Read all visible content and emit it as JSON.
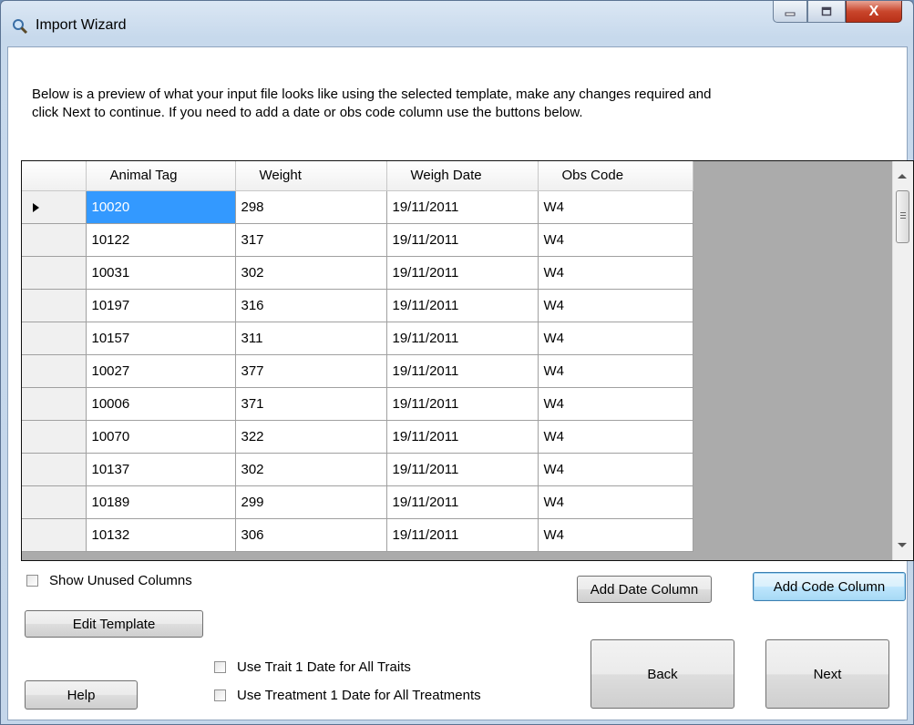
{
  "window": {
    "title": "Import Wizard"
  },
  "instructions": {
    "line1": "Below is a preview of what your input file looks like using the selected template, make any changes required and",
    "line2": "click Next to continue. If you need to add a date or obs code column use the buttons below."
  },
  "grid": {
    "columns": [
      "Animal Tag",
      "Weight",
      "Weigh Date",
      "Obs Code"
    ],
    "rows": [
      [
        "10020",
        "298",
        "19/11/2011",
        "W4"
      ],
      [
        "10122",
        "317",
        "19/11/2011",
        "W4"
      ],
      [
        "10031",
        "302",
        "19/11/2011",
        "W4"
      ],
      [
        "10197",
        "316",
        "19/11/2011",
        "W4"
      ],
      [
        "10157",
        "311",
        "19/11/2011",
        "W4"
      ],
      [
        "10027",
        "377",
        "19/11/2011",
        "W4"
      ],
      [
        "10006",
        "371",
        "19/11/2011",
        "W4"
      ],
      [
        "10070",
        "322",
        "19/11/2011",
        "W4"
      ],
      [
        "10137",
        "302",
        "19/11/2011",
        "W4"
      ],
      [
        "10189",
        "299",
        "19/11/2011",
        "W4"
      ],
      [
        "10132",
        "306",
        "19/11/2011",
        "W4"
      ]
    ],
    "selected_cell": "10020"
  },
  "options": {
    "show_unused_columns": "Show Unused Columns",
    "use_trait_date": "Use Trait 1 Date for All Traits",
    "use_treatment_date": "Use Treatment 1 Date for All Treatments"
  },
  "buttons": {
    "add_date_column": "Add Date Column",
    "add_code_column": "Add Code Column",
    "edit_template": "Edit Template",
    "help": "Help",
    "back": "Back",
    "next": "Next"
  },
  "caption": {
    "close": "X"
  }
}
